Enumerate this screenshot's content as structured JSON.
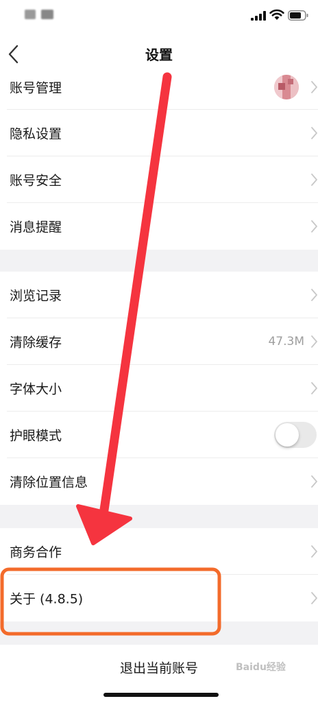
{
  "nav": {
    "title": "设置"
  },
  "group1": [
    {
      "label": "账号管理",
      "trailing": "avatar"
    },
    {
      "label": "隐私设置"
    },
    {
      "label": "账号安全"
    },
    {
      "label": "消息提醒"
    }
  ],
  "group2": [
    {
      "label": "浏览记录"
    },
    {
      "label": "清除缓存",
      "value": "47.3M"
    },
    {
      "label": "字体大小"
    },
    {
      "label": "护眼模式",
      "toggle": false
    },
    {
      "label": "清除位置信息"
    }
  ],
  "group3": [
    {
      "label": "商务合作"
    },
    {
      "label": "关于 (4.8.5)"
    }
  ],
  "logout": {
    "label": "退出当前账号"
  },
  "watermark": {
    "text": "Baidu经验"
  },
  "colors": {
    "arrow": "#f5343f",
    "highlight": "#f36b2b",
    "section_gap": "#f2f2f4",
    "chevron": "#c8c8c8"
  }
}
